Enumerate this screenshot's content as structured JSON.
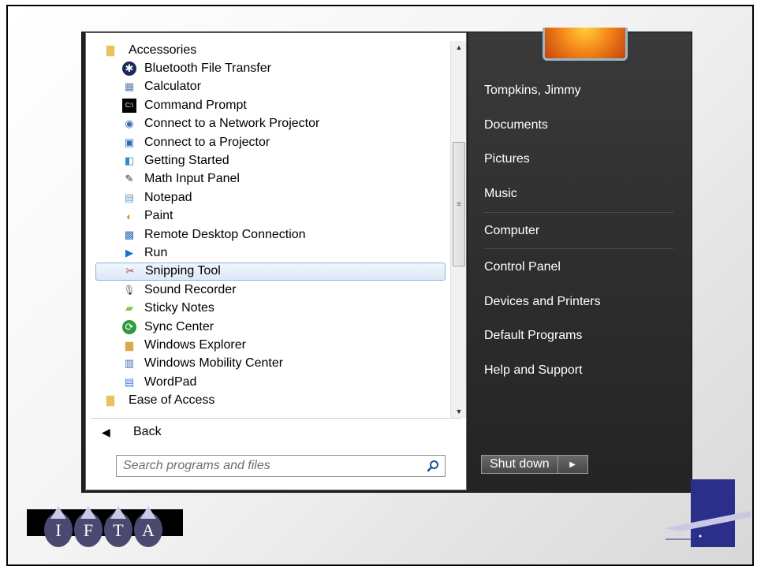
{
  "start_menu": {
    "programs": [
      {
        "label": "Accessories",
        "icon": "folder-icon",
        "type": "folder"
      },
      {
        "label": "Bluetooth File Transfer",
        "icon": "bluetooth-icon"
      },
      {
        "label": "Calculator",
        "icon": "calculator-icon"
      },
      {
        "label": "Command Prompt",
        "icon": "command-prompt-icon"
      },
      {
        "label": "Connect to a Network Projector",
        "icon": "network-projector-icon"
      },
      {
        "label": "Connect to a Projector",
        "icon": "projector-icon"
      },
      {
        "label": "Getting Started",
        "icon": "getting-started-icon"
      },
      {
        "label": "Math Input Panel",
        "icon": "math-input-icon"
      },
      {
        "label": "Notepad",
        "icon": "notepad-icon"
      },
      {
        "label": "Paint",
        "icon": "paint-icon"
      },
      {
        "label": "Remote Desktop Connection",
        "icon": "remote-desktop-icon"
      },
      {
        "label": "Run",
        "icon": "run-icon"
      },
      {
        "label": "Snipping Tool",
        "icon": "snipping-tool-icon",
        "selected": true
      },
      {
        "label": "Sound Recorder",
        "icon": "microphone-icon"
      },
      {
        "label": "Sticky Notes",
        "icon": "sticky-notes-icon"
      },
      {
        "label": "Sync Center",
        "icon": "sync-icon"
      },
      {
        "label": "Windows Explorer",
        "icon": "explorer-folder-icon"
      },
      {
        "label": "Windows Mobility Center",
        "icon": "mobility-center-icon"
      },
      {
        "label": "WordPad",
        "icon": "wordpad-icon"
      },
      {
        "label": "Ease of Access",
        "icon": "folder-icon",
        "type": "folder"
      }
    ],
    "back_label": "Back",
    "search_placeholder": "Search programs and files",
    "places": [
      {
        "label": "Tompkins, Jimmy"
      },
      {
        "label": "Documents"
      },
      {
        "label": "Pictures"
      },
      {
        "label": "Music"
      },
      {
        "label": "Computer"
      },
      {
        "label": "Control Panel"
      },
      {
        "label": "Devices and Printers"
      },
      {
        "label": "Default Programs"
      },
      {
        "label": "Help and Support"
      }
    ],
    "shutdown_label": "Shut down"
  },
  "logo": {
    "text": "IFTA"
  },
  "colors": {
    "menu_dark": "#2c2c2c",
    "selection": "#dbe8f7",
    "selection_border": "#8fb3dd",
    "logo_navy": "#2b2f8a"
  }
}
